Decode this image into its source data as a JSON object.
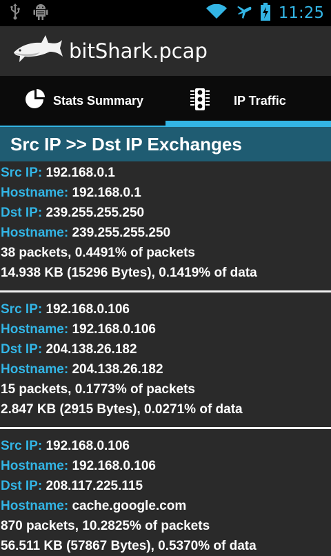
{
  "status_bar": {
    "time": "11:25",
    "left_icons": [
      "usb-icon",
      "android-debug-icon"
    ],
    "right_icons": [
      "wifi-icon",
      "airplane-icon",
      "battery-charging-icon"
    ]
  },
  "action_bar": {
    "app_title": "bitShark.pcap",
    "logo_icon": "shark-logo-icon"
  },
  "tabs": [
    {
      "label": "Stats Summary",
      "icon": "pie-chart-icon",
      "selected": false
    },
    {
      "label": "IP Traffic",
      "icon": "traffic-light-icon",
      "selected": true
    }
  ],
  "section": {
    "title": "Src IP >> Dst IP Exchanges"
  },
  "labels": {
    "src_ip": "Src IP:",
    "hostname": "Hostname:",
    "dst_ip": "Dst IP:"
  },
  "exchanges": [
    {
      "src_ip": "192.168.0.1",
      "src_hostname": "192.168.0.1",
      "dst_ip": "239.255.255.250",
      "dst_hostname": "239.255.255.250",
      "packets_line": "38 packets, 0.4491% of packets",
      "data_line": "14.938 KB (15296 Bytes), 0.1419% of data"
    },
    {
      "src_ip": "192.168.0.106",
      "src_hostname": "192.168.0.106",
      "dst_ip": "204.138.26.182",
      "dst_hostname": "204.138.26.182",
      "packets_line": "15 packets, 0.1773% of packets",
      "data_line": "2.847 KB (2915 Bytes), 0.0271% of data"
    },
    {
      "src_ip": "192.168.0.106",
      "src_hostname": "192.168.0.106",
      "dst_ip": "208.117.225.115",
      "dst_hostname": "cache.google.com",
      "packets_line": "870 packets, 10.2825% of packets",
      "data_line": "56.511 KB (57867 Bytes), 0.5370% of data"
    }
  ],
  "colors": {
    "accent": "#33b5e5",
    "section_header_bg": "#1f5c72",
    "background": "#2a2a2a"
  }
}
